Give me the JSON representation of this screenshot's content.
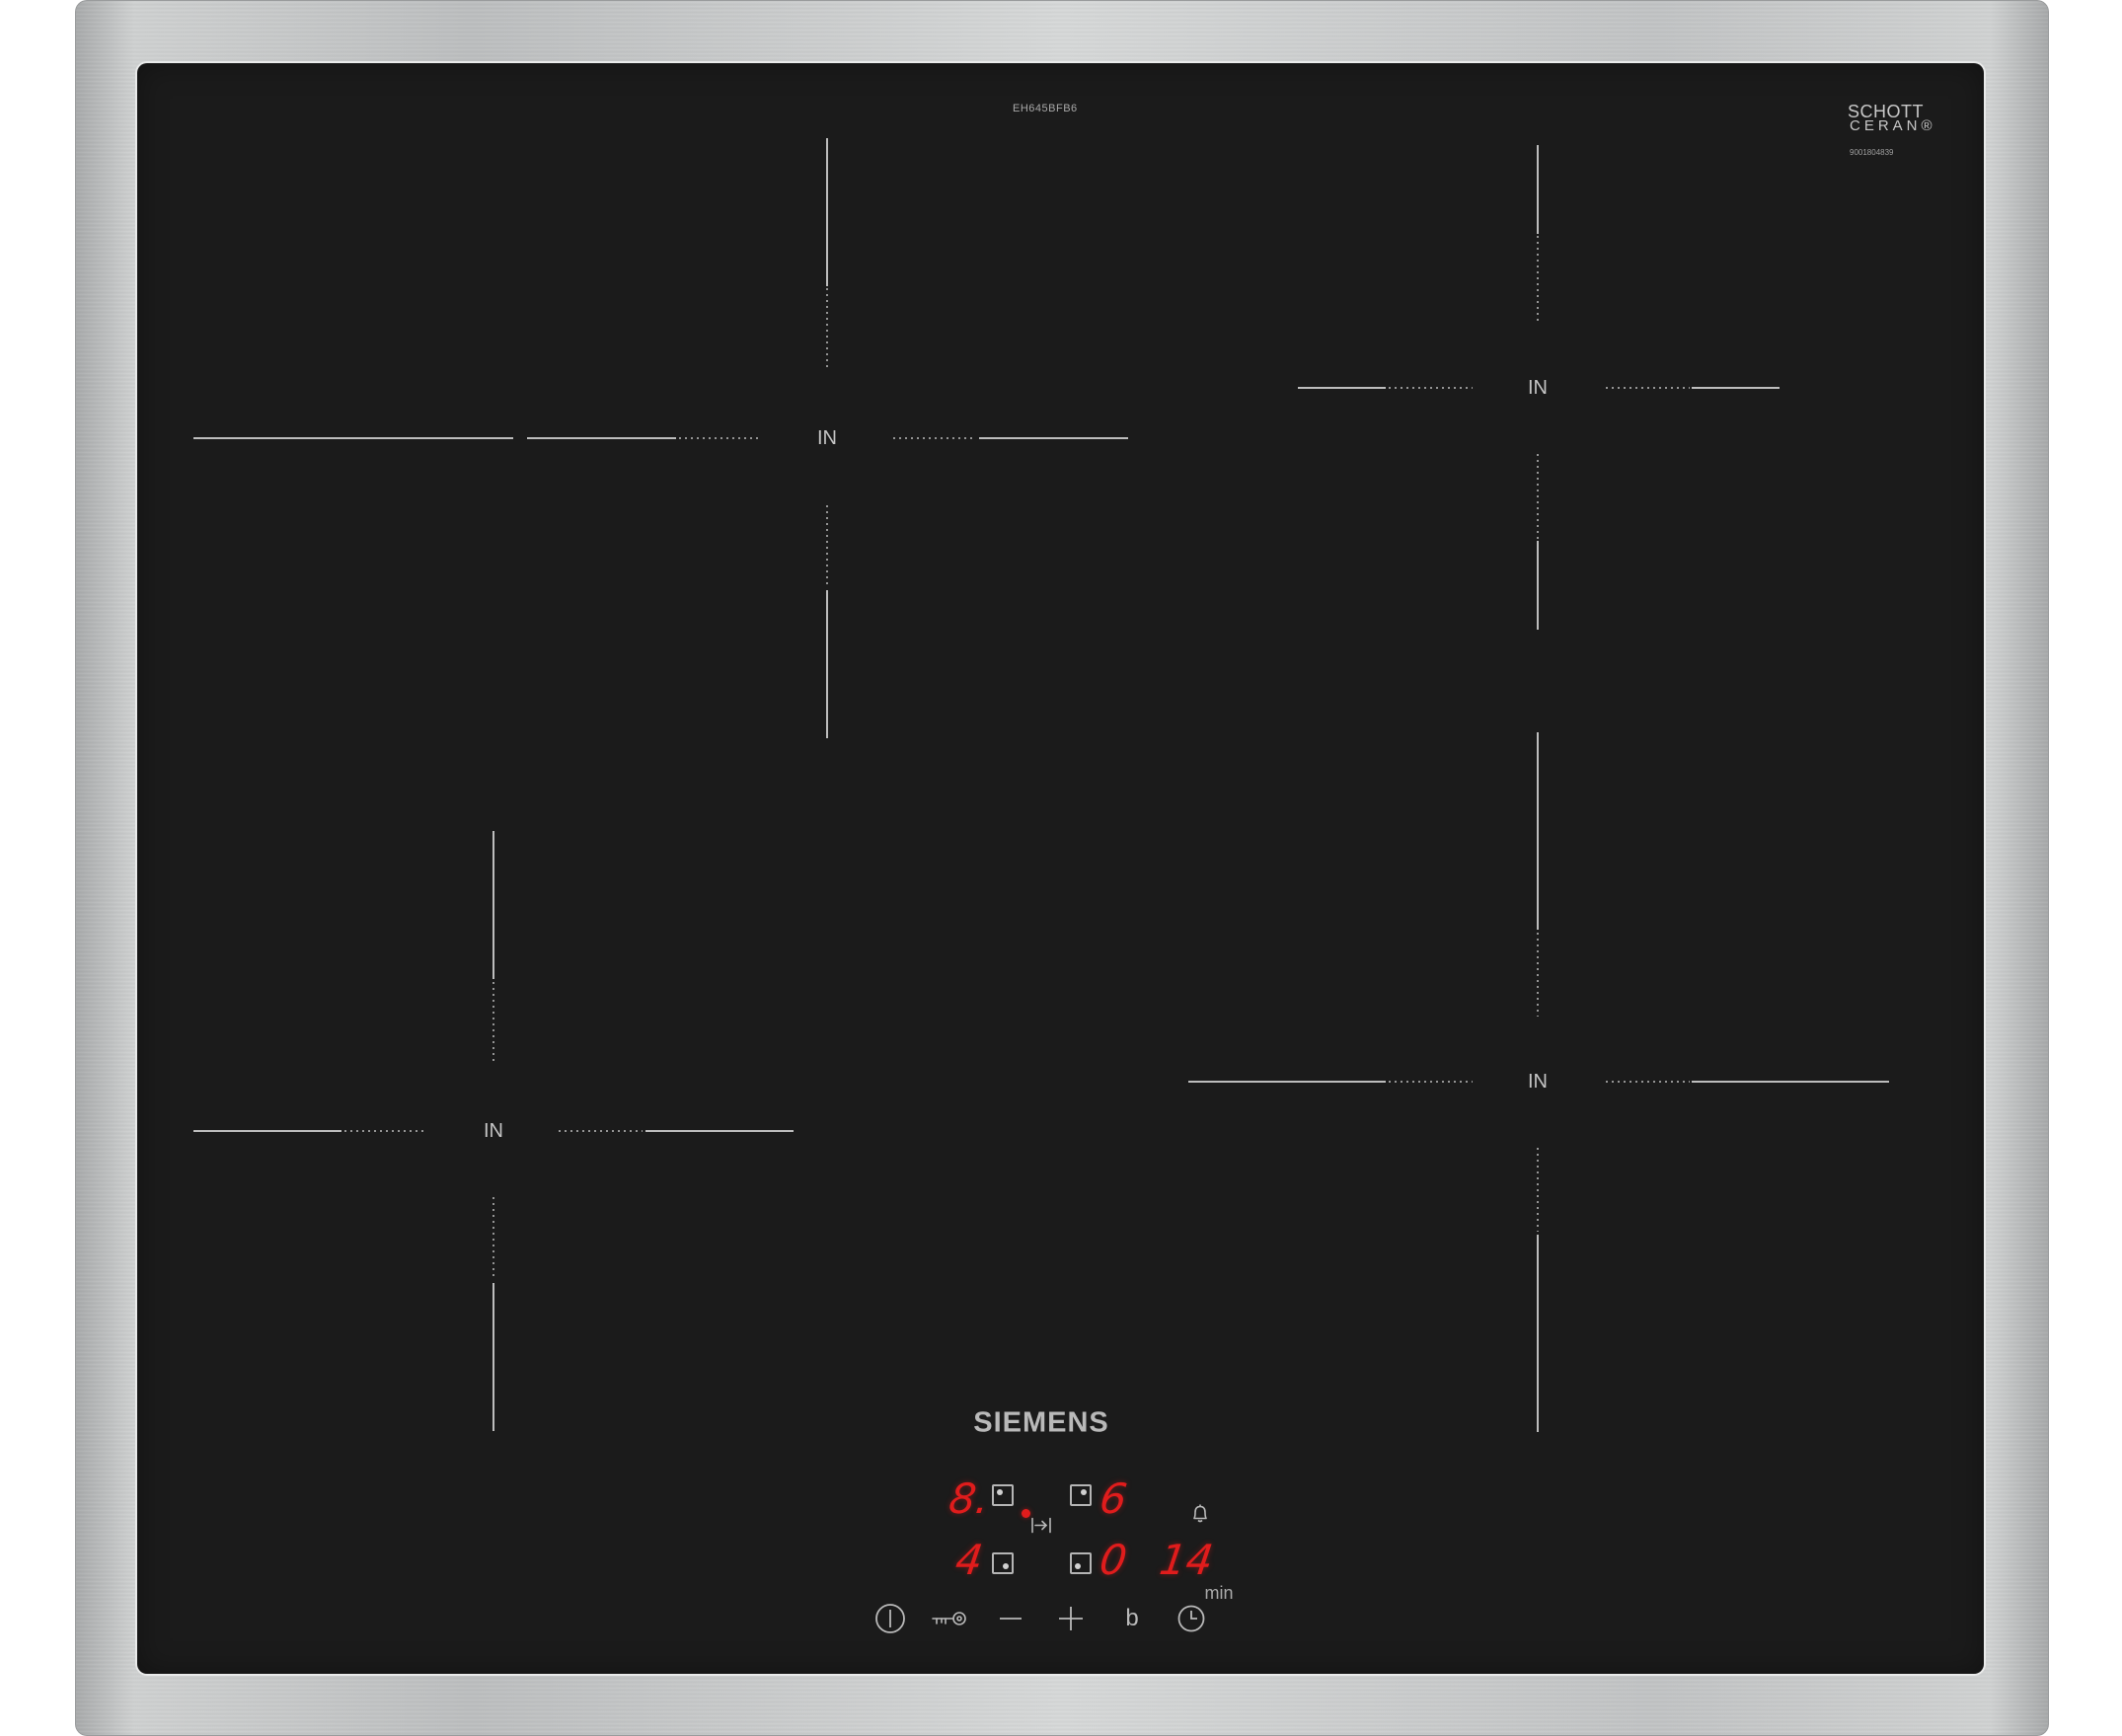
{
  "appliance": {
    "model_number": "EH645BFB6",
    "glass_brand": {
      "line1": "SCHOTT",
      "line2": "CERAN®",
      "serial": "9001804839"
    },
    "brand": "SIEMENS"
  },
  "zones": [
    {
      "id": "rear-left",
      "label": "IN"
    },
    {
      "id": "rear-right",
      "label": "IN"
    },
    {
      "id": "front-left",
      "label": "IN"
    },
    {
      "id": "front-right",
      "label": "IN"
    }
  ],
  "display": {
    "rear_left_level": "8.",
    "rear_right_level": "6",
    "front_left_level": "4",
    "front_right_level": "0",
    "timer_value": "14",
    "timer_unit": "min"
  },
  "controls": {
    "power_icon": "power-icon",
    "lock_icon": "child-lock-key-icon",
    "minus_icon": "minus-icon",
    "plus_icon": "plus-icon",
    "boost_label": "b",
    "timer_icon": "clock-icon",
    "alarm_icon": "bell-icon",
    "transfer_icon": "arrow-to-bar-icon"
  },
  "colors": {
    "glass": "#1b1b1b",
    "frame": "#c6c8c9",
    "print": "#b9b9b9",
    "display_red": "#e01c1c"
  }
}
